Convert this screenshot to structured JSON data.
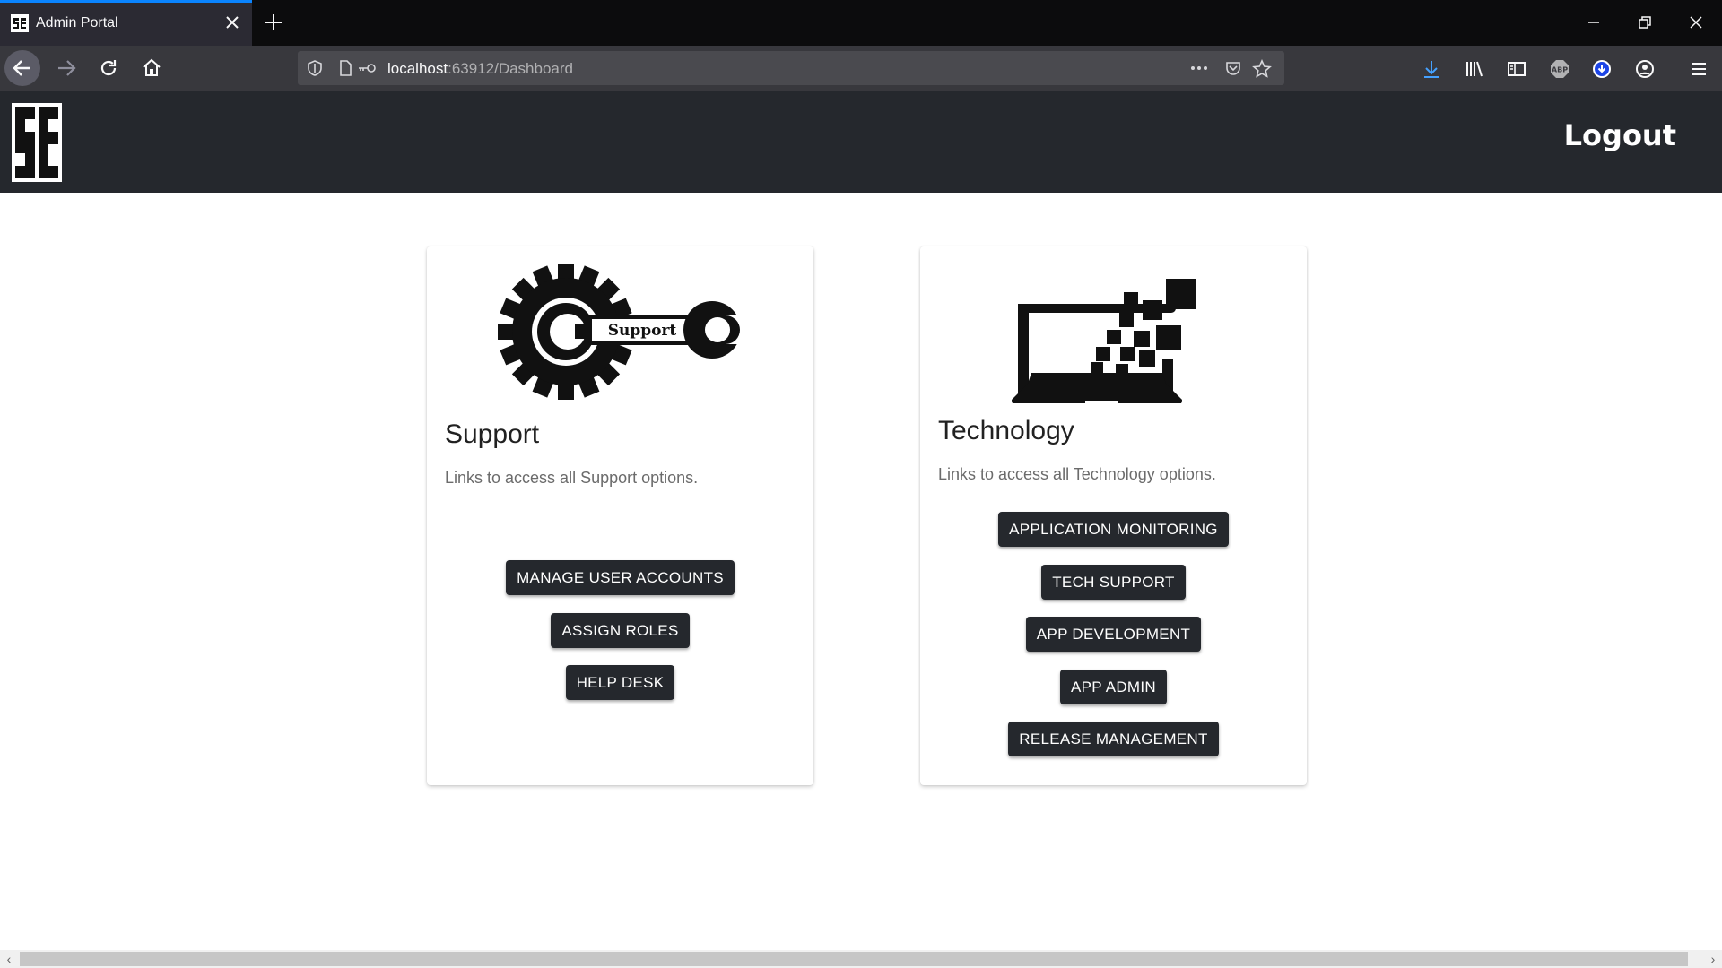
{
  "browser": {
    "tab_title": "Admin Portal",
    "url_host": "localhost",
    "url_path": ":63912/Dashboard"
  },
  "header": {
    "logout_label": "Logout"
  },
  "cards": {
    "support": {
      "image_label": "Support",
      "title": "Support",
      "description": "Links to access all Support options.",
      "buttons": [
        "MANAGE USER ACCOUNTS",
        "ASSIGN ROLES",
        "HELP DESK"
      ]
    },
    "technology": {
      "title": "Technology",
      "description": "Links to access all Technology options.",
      "buttons": [
        "APPLICATION MONITORING",
        "TECH SUPPORT",
        "APP DEVELOPMENT",
        "APP ADMIN",
        "RELEASE MANAGEMENT"
      ]
    }
  },
  "icons": {
    "tab_favicon": "se-logo-icon",
    "logo": "se-logo-icon",
    "support_image": "gear-wrench-icon",
    "technology_image": "laptop-pixels-icon"
  },
  "colors": {
    "header_bg": "#25282d",
    "button_bg": "#25282d",
    "tab_accent": "#0a84ff"
  }
}
